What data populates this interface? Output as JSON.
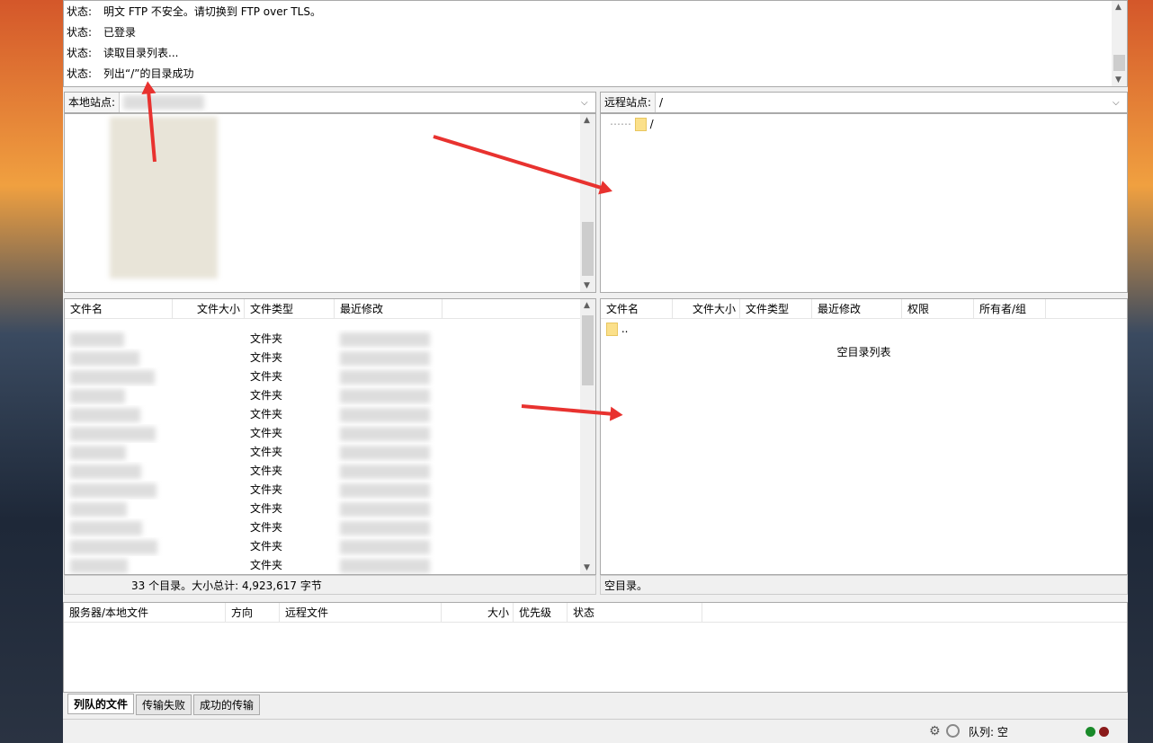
{
  "log": [
    {
      "label": "状态:",
      "text": "明文 FTP 不安全。请切换到 FTP over TLS。"
    },
    {
      "label": "状态:",
      "text": "已登录"
    },
    {
      "label": "状态:",
      "text": "读取目录列表..."
    },
    {
      "label": "状态:",
      "text": "列出“/”的目录成功"
    }
  ],
  "local": {
    "site_label": "本地站点:",
    "columns": [
      "文件名",
      "文件大小",
      "文件类型",
      "最近修改"
    ],
    "rows": [
      "文件夹",
      "文件夹",
      "文件夹",
      "文件夹",
      "文件夹",
      "文件夹",
      "文件夹",
      "文件夹",
      "文件夹",
      "文件夹",
      "文件夹",
      "文件夹",
      "文件夹"
    ],
    "status": "33 个目录。大小总计: 4,923,617 字节"
  },
  "remote": {
    "site_label": "远程站点:",
    "path": "/",
    "tree_root": "/",
    "columns": [
      "文件名",
      "文件大小",
      "文件类型",
      "最近修改",
      "权限",
      "所有者/组"
    ],
    "parent": "..",
    "empty_text": "空目录列表",
    "status": "空目录。"
  },
  "queue": {
    "columns": [
      "服务器/本地文件",
      "方向",
      "远程文件",
      "大小",
      "优先级",
      "状态"
    ],
    "tabs": [
      "列队的文件",
      "传输失败",
      "成功的传输"
    ]
  },
  "statusbar": {
    "queue": "队列: 空"
  },
  "colors": {
    "arrow": "#e8322f",
    "folder": "#fbe08a"
  }
}
